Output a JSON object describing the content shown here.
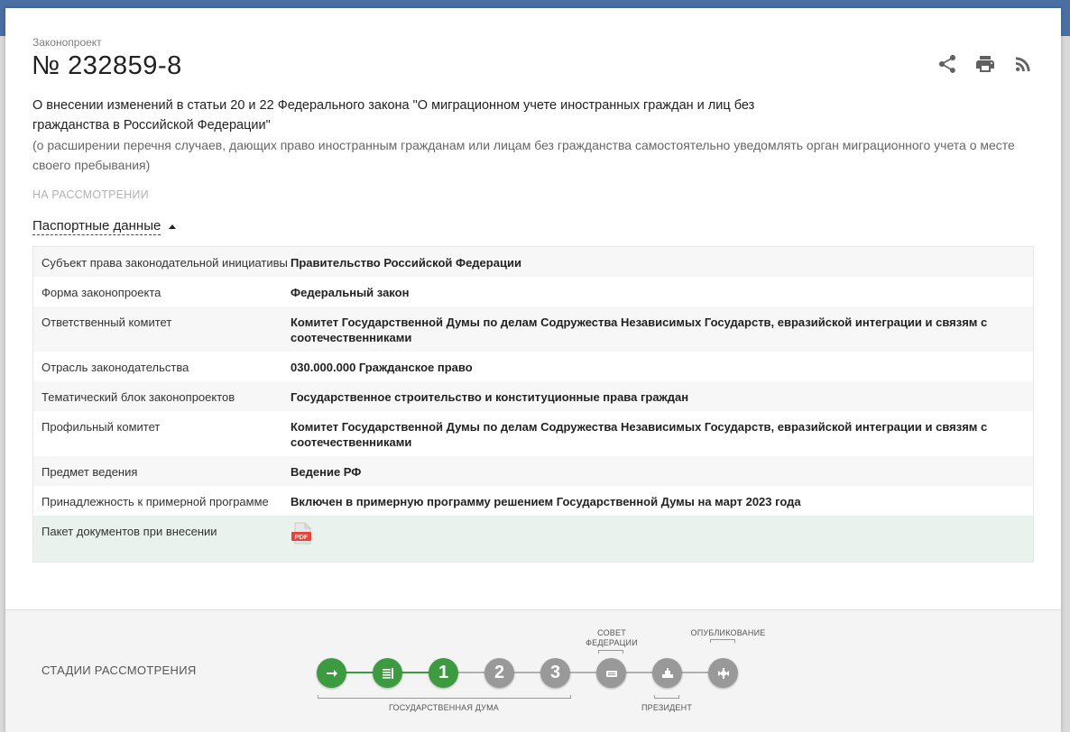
{
  "header": {
    "kicker": "Законопроект",
    "number": "№ 232859-8",
    "actions": [
      {
        "name": "share-icon"
      },
      {
        "name": "print-icon"
      },
      {
        "name": "rss-icon"
      }
    ]
  },
  "bill": {
    "title": "О внесении изменений в статьи 20 и 22 Федерального закона \"О миграционном учете иностранных граждан и лиц без гражданства в Российской Федерации\"",
    "subtitle": "(о расширении перечня случаев, дающих право иностранным гражданам или лицам без гражданства самостоятельно уведомлять орган миграционного учета о месте своего пребывания)",
    "status": "НА РАССМОТРЕНИИ"
  },
  "passport": {
    "toggle_label": "Паспортные данные",
    "rows": [
      {
        "key": "Субъект права законодательной инициативы",
        "value": "Правительство Российской Федерации"
      },
      {
        "key": "Форма законопроекта",
        "value": "Федеральный закон"
      },
      {
        "key": "Ответственный комитет",
        "value": "Комитет Государственной Думы по делам Содружества Независимых Государств, евразийской интеграции и связям с соотечественниками"
      },
      {
        "key": "Отрасль законодательства",
        "value": "030.000.000 Гражданское право"
      },
      {
        "key": "Тематический блок законопроектов",
        "value": "Государственное строительство и конституционные права граждан"
      },
      {
        "key": "Профильный комитет",
        "value": "Комитет Государственной Думы по делам Содружества Независимых Государств, евразийской интеграции и связям с соотечественниками"
      },
      {
        "key": "Предмет ведения",
        "value": "Ведение РФ"
      },
      {
        "key": "Принадлежность к примерной программе",
        "value": "Включен в примерную программу решением Государственной Думы на март 2023 года"
      },
      {
        "key": "Пакет документов при внесении",
        "value": "",
        "icon": "pdf-icon",
        "icon_text": "PDF"
      }
    ]
  },
  "stages": {
    "title": "СТАДИИ РАССМОТРЕНИЯ",
    "steps": [
      {
        "name": "stage-introduction",
        "icon": "arrow-right-icon",
        "state": "done"
      },
      {
        "name": "stage-preliminary",
        "icon": "document-icon",
        "state": "done"
      },
      {
        "name": "stage-reading-1",
        "label": "1",
        "state": "active"
      },
      {
        "name": "stage-reading-2",
        "label": "2",
        "state": "pending"
      },
      {
        "name": "stage-reading-3",
        "label": "3",
        "state": "pending"
      },
      {
        "name": "stage-federation-council",
        "icon": "council-icon",
        "state": "pending"
      },
      {
        "name": "stage-president",
        "icon": "president-icon",
        "state": "pending"
      },
      {
        "name": "stage-publication",
        "icon": "emblem-icon",
        "state": "pending"
      }
    ],
    "labels": {
      "duma": "ГОСУДАРСТВЕННАЯ ДУМА",
      "council_line1": "СОВЕТ",
      "council_line2": "ФЕДЕРАЦИИ",
      "president": "ПРЕЗИДЕНТ",
      "publication": "ОПУБЛИКОВАНИЕ"
    },
    "colors": {
      "done": "#3c9a40",
      "pending": "#999999"
    }
  }
}
